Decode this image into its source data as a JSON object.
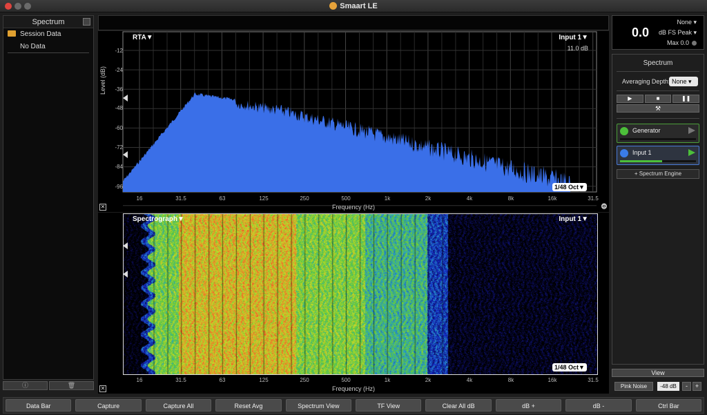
{
  "window": {
    "title": "Smaart LE"
  },
  "left_panel": {
    "title": "Spectrum",
    "tree": {
      "root": "Session Data",
      "child": "No Data"
    },
    "bottom_buttons": [
      "ⓘ",
      "🗑"
    ]
  },
  "rta": {
    "label": "RTA▼",
    "input": "Input 1▼",
    "readout": "11.0 dB",
    "y_axis_label": "Level (dB)",
    "y_ticks": [
      "-12",
      "-24",
      "-36",
      "-48",
      "-60",
      "-72",
      "-84",
      "-96"
    ],
    "x_ticks": [
      "16",
      "31.5",
      "63",
      "125",
      "250",
      "500",
      "1k",
      "2k",
      "4k",
      "8k",
      "16k",
      "31.5"
    ],
    "x_axis_label": "Frequency (Hz)",
    "resolution": "1/48 Oct▼",
    "fill_color": "#3a6fe8"
  },
  "spectrograph": {
    "label": "Spectrograph▼",
    "input": "Input 1▼",
    "x_ticks": [
      "16",
      "31.5",
      "63",
      "125",
      "250",
      "500",
      "1k",
      "2k",
      "4k",
      "8k",
      "16k",
      "31.5"
    ],
    "x_axis_label": "Frequency (Hz)",
    "resolution": "1/48 Oct▼"
  },
  "meter": {
    "value": "0.0",
    "source": "None",
    "scale": "dB FS Peak",
    "max": "Max 0.0"
  },
  "right_panel": {
    "title": "Spectrum",
    "averaging_label": "Averaging Depth:",
    "averaging_value": "None",
    "transport": [
      "▶",
      "■",
      "❚❚"
    ],
    "tools_icon": "⚒",
    "channels": [
      {
        "name": "Generator",
        "color": "#4cbf3a",
        "active": false,
        "level": 0
      },
      {
        "name": "Input 1",
        "color": "#3a7be8",
        "active": true,
        "level": 0.55
      }
    ],
    "engine_button": "+ Spectrum Engine"
  },
  "view_button": "View",
  "generator": {
    "signal": "Pink Noise",
    "level": "-48 dB",
    "minus": "-",
    "plus": "+"
  },
  "command_bar": [
    "Data Bar",
    "Capture",
    "Capture All",
    "Reset Avg",
    "Spectrum View",
    "TF View",
    "Clear All dB",
    "dB +",
    "dB -",
    "Ctrl Bar"
  ]
}
